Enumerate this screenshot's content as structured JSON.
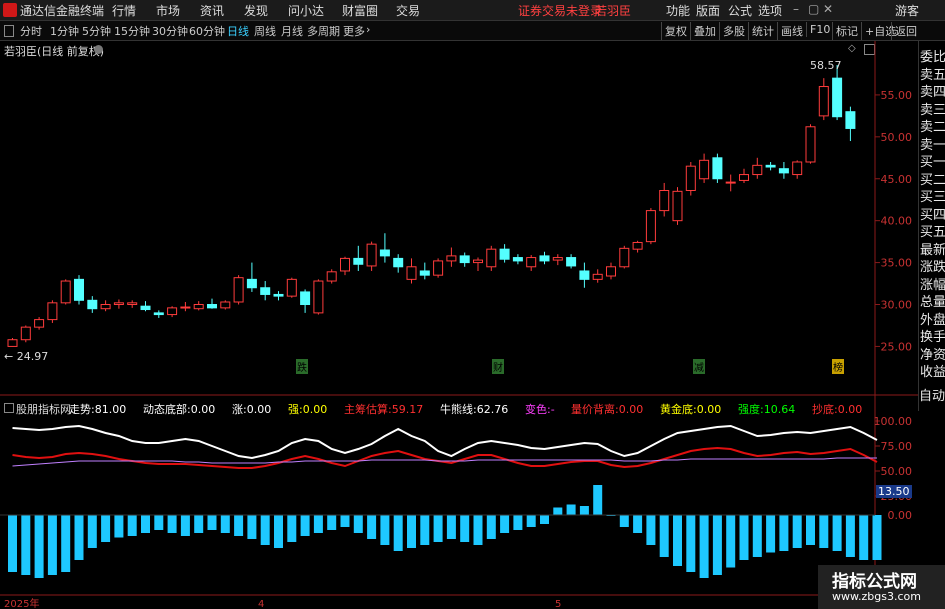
{
  "menubar": {
    "app_title": "通达信金融终端",
    "menus": [
      "行情",
      "市场",
      "资讯",
      "发现",
      "问小达",
      "财富圈",
      "交易"
    ],
    "login_status": "证券交易未登录",
    "stock_name": "若羽臣",
    "right_menus": [
      "功能",
      "版面",
      "公式",
      "选项"
    ],
    "user": "游客"
  },
  "periodbar": {
    "periods": [
      "分时",
      "1分钟",
      "5分钟",
      "15分钟",
      "30分钟",
      "60分钟",
      "日线",
      "周线",
      "月线",
      "多周期",
      "更多"
    ],
    "active_period": "日线",
    "tools": [
      "复权",
      "叠加",
      "多股",
      "统计",
      "画线",
      "F10",
      "标记",
      "+自选",
      "返回"
    ]
  },
  "chart_header": {
    "title": "若羽臣(日线 前复权)"
  },
  "right_panel": {
    "items": [
      "委比",
      "卖五",
      "卖四",
      "卖三",
      "卖二",
      "卖一",
      "买一",
      "买二",
      "买三",
      "买四",
      "买五",
      "最新",
      "涨跌",
      "涨幅",
      "总量",
      "外盘",
      "换手",
      "净资",
      "收益",
      "自动"
    ]
  },
  "indicator": {
    "name": "股朋指标网",
    "fields": [
      {
        "label": "走势:",
        "value": "81.00",
        "color": "#ffffff"
      },
      {
        "label": "动态底部:",
        "value": "0.00",
        "color": "#ffffff"
      },
      {
        "label": "涨:",
        "value": "0.00",
        "color": "#ffffff"
      },
      {
        "label": "强:",
        "value": "0.00",
        "color": "#ffff00"
      },
      {
        "label": "主筹估算:",
        "value": "59.17",
        "color": "#ff3030"
      },
      {
        "label": "牛熊线:",
        "value": "62.76",
        "color": "#ffffff"
      },
      {
        "label": "变色:",
        "value": "-",
        "color": "#ff40ff"
      },
      {
        "label": "量价背离:",
        "value": "0.00",
        "color": "#ff3030"
      },
      {
        "label": "黄金底:",
        "value": "0.00",
        "color": "#ffff00"
      },
      {
        "label": "强度:",
        "value": "10.64",
        "color": "#00ff00"
      },
      {
        "label": "抄底:",
        "value": "0.00",
        "color": "#ff3030"
      }
    ]
  },
  "markers": {
    "low_label": "24.97",
    "high_label": "58.57",
    "events": [
      "跌",
      "财",
      "减",
      "榜"
    ],
    "side_value": "13.50"
  },
  "x_axis_labels": [
    "2025年",
    "4",
    "5"
  ],
  "watermark": {
    "line1": "指标公式网",
    "line2": "www.zbgs3.com"
  },
  "chart_data": [
    {
      "type": "candlestick",
      "title": "若羽臣(日线 前复权)",
      "y_ticks": [
        25,
        30,
        35,
        40,
        45,
        50,
        55
      ],
      "ylim": [
        23.5,
        60
      ],
      "candles": [
        [
          25.0,
          26.0,
          24.97,
          25.8
        ],
        [
          25.8,
          27.5,
          25.5,
          27.3
        ],
        [
          27.3,
          28.5,
          27.0,
          28.2
        ],
        [
          28.2,
          30.5,
          27.8,
          30.2
        ],
        [
          30.2,
          33.0,
          30.0,
          32.8
        ],
        [
          33.0,
          33.5,
          30.0,
          30.5
        ],
        [
          30.5,
          31.0,
          29.0,
          29.5
        ],
        [
          29.5,
          30.5,
          29.2,
          30.0
        ],
        [
          30.0,
          30.6,
          29.5,
          30.2
        ],
        [
          30.0,
          30.5,
          29.6,
          30.2
        ],
        [
          29.8,
          30.4,
          29.2,
          29.4
        ],
        [
          29.0,
          29.3,
          28.4,
          28.8
        ],
        [
          28.8,
          29.8,
          28.5,
          29.6
        ],
        [
          29.6,
          30.3,
          29.2,
          29.7
        ],
        [
          29.5,
          30.4,
          29.3,
          30.0
        ],
        [
          30.0,
          30.7,
          29.5,
          29.6
        ],
        [
          29.6,
          30.5,
          29.4,
          30.3
        ],
        [
          30.3,
          33.5,
          30.0,
          33.2
        ],
        [
          33.0,
          35.0,
          31.5,
          32.0
        ],
        [
          32.0,
          32.8,
          30.5,
          31.2
        ],
        [
          31.2,
          31.6,
          30.5,
          31.0
        ],
        [
          31.0,
          33.2,
          30.8,
          33.0
        ],
        [
          31.5,
          31.8,
          29.0,
          30.0
        ],
        [
          29.0,
          33.0,
          28.8,
          32.8
        ],
        [
          32.8,
          34.2,
          32.5,
          33.9
        ],
        [
          34.0,
          35.7,
          33.5,
          35.5
        ],
        [
          35.5,
          37.0,
          34.0,
          34.8
        ],
        [
          34.6,
          37.5,
          34.0,
          37.2
        ],
        [
          36.5,
          38.5,
          35.0,
          35.8
        ],
        [
          35.5,
          36.0,
          33.8,
          34.5
        ],
        [
          33.0,
          35.5,
          32.5,
          34.5
        ],
        [
          34.0,
          35.0,
          33.0,
          33.5
        ],
        [
          33.5,
          35.5,
          33.2,
          35.2
        ],
        [
          35.2,
          36.8,
          34.5,
          35.8
        ],
        [
          35.8,
          36.2,
          34.5,
          35.0
        ],
        [
          35.0,
          35.6,
          34.0,
          35.3
        ],
        [
          34.5,
          37.0,
          34.0,
          36.6
        ],
        [
          36.6,
          37.2,
          35.0,
          35.4
        ],
        [
          35.6,
          36.0,
          34.8,
          35.2
        ],
        [
          34.5,
          35.9,
          34.0,
          35.6
        ],
        [
          35.8,
          36.3,
          34.8,
          35.2
        ],
        [
          35.3,
          36.0,
          34.7,
          35.6
        ],
        [
          35.6,
          36.0,
          34.3,
          34.6
        ],
        [
          34.0,
          35.0,
          32.0,
          33.0
        ],
        [
          33.0,
          34.2,
          32.6,
          33.6
        ],
        [
          33.4,
          35.0,
          33.0,
          34.5
        ],
        [
          34.5,
          37.0,
          34.3,
          36.7
        ],
        [
          36.6,
          37.6,
          36.2,
          37.4
        ],
        [
          37.5,
          41.5,
          37.2,
          41.2
        ],
        [
          41.2,
          44.5,
          40.5,
          43.6
        ],
        [
          40.0,
          44.0,
          39.5,
          43.5
        ],
        [
          43.6,
          47.0,
          43.0,
          46.5
        ],
        [
          45.0,
          48.0,
          44.5,
          47.2
        ],
        [
          47.5,
          48.0,
          44.5,
          45.0
        ],
        [
          44.5,
          45.5,
          43.5,
          44.6
        ],
        [
          44.8,
          46.2,
          44.5,
          45.5
        ],
        [
          45.5,
          47.5,
          45.0,
          46.6
        ],
        [
          46.6,
          47.0,
          46.0,
          46.4
        ],
        [
          46.2,
          47.0,
          45.0,
          45.7
        ],
        [
          45.5,
          47.2,
          45.0,
          47.0
        ],
        [
          47.0,
          51.5,
          46.8,
          51.2
        ],
        [
          52.5,
          57.0,
          52.0,
          56.0
        ],
        [
          57.0,
          58.57,
          52.0,
          52.4
        ],
        [
          53.0,
          53.6,
          49.5,
          51.0
        ]
      ]
    },
    {
      "type": "line",
      "title": "股朋指标网",
      "y_ticks": [
        25.0,
        50.0,
        75.0,
        100.0
      ],
      "ylim": [
        0,
        115
      ],
      "series": [
        {
          "name": "走势",
          "values": [
            93,
            92,
            91,
            92,
            94,
            95,
            92,
            88,
            85,
            80,
            78,
            78,
            80,
            82,
            80,
            75,
            70,
            65,
            63,
            66,
            70,
            78,
            82,
            80,
            72,
            68,
            72,
            77,
            85,
            92,
            85,
            80,
            70,
            65,
            72,
            78,
            80,
            78,
            76,
            73,
            72,
            74,
            76,
            78,
            77,
            70,
            65,
            68,
            75,
            82,
            88,
            90,
            92,
            94,
            95,
            90,
            85,
            86,
            88,
            89,
            88,
            90,
            92,
            94,
            88,
            81
          ]
        },
        {
          "name": "主筹估算",
          "values": [
            66,
            64,
            63,
            64,
            67,
            68,
            67,
            65,
            62,
            60,
            58,
            57,
            57,
            57,
            56,
            55,
            54,
            53,
            53,
            55,
            58,
            62,
            65,
            62,
            58,
            55,
            60,
            65,
            68,
            70,
            66,
            62,
            60,
            58,
            62,
            66,
            66,
            62,
            58,
            55,
            55,
            57,
            59,
            60,
            60,
            56,
            54,
            55,
            58,
            62,
            66,
            70,
            72,
            73,
            72,
            68,
            65,
            66,
            68,
            69,
            67,
            68,
            70,
            72,
            66,
            59
          ]
        },
        {
          "name": "牛熊线",
          "values": [
            55,
            56,
            57,
            58,
            59,
            60,
            60,
            60,
            60,
            60,
            60,
            60,
            60,
            59,
            59,
            58,
            58,
            58,
            58,
            58,
            59,
            59,
            60,
            60,
            60,
            60,
            60,
            61,
            61,
            61,
            61,
            61,
            60,
            60,
            60,
            61,
            61,
            61,
            61,
            61,
            61,
            61,
            61,
            61,
            61,
            61,
            60,
            60,
            60,
            61,
            61,
            62,
            62,
            62,
            62,
            62,
            62,
            62,
            62,
            62,
            62,
            62,
            63,
            63,
            63,
            63
          ]
        }
      ]
    },
    {
      "type": "bar",
      "title": "",
      "y_ticks": [
        0.0
      ],
      "values": [
        -38,
        -40,
        -42,
        -40,
        -38,
        -30,
        -22,
        -18,
        -15,
        -14,
        -12,
        -10,
        -12,
        -14,
        -12,
        -10,
        -12,
        -14,
        -16,
        -20,
        -22,
        -18,
        -14,
        -12,
        -10,
        -8,
        -12,
        -16,
        -20,
        -24,
        -22,
        -20,
        -18,
        -16,
        -18,
        -20,
        -16,
        -12,
        -10,
        -8,
        -6,
        5,
        7,
        6,
        20,
        0,
        -8,
        -12,
        -20,
        -28,
        -34,
        -38,
        -42,
        -40,
        -35,
        -30,
        -28,
        -25,
        -24,
        -22,
        -20,
        -22,
        -24,
        -28,
        -30,
        -30
      ]
    }
  ]
}
